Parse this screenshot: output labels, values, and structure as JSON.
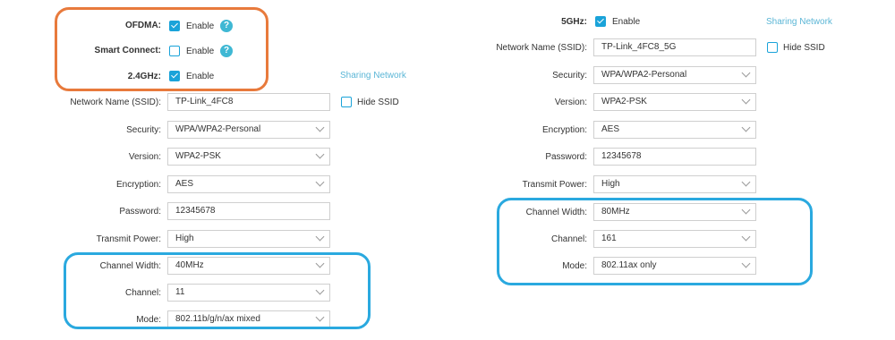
{
  "left": {
    "ofdma": {
      "label": "OFDMA:",
      "checkbox_label": "Enable",
      "checked": true
    },
    "smart_connect": {
      "label": "Smart Connect:",
      "checkbox_label": "Enable",
      "checked": false
    },
    "band_24": {
      "label": "2.4GHz:",
      "checkbox_label": "Enable",
      "checked": true
    },
    "sharing_network_link": "Sharing Network",
    "ssid": {
      "label": "Network Name (SSID):",
      "value": "TP-Link_4FC8"
    },
    "hide_ssid": "Hide SSID",
    "security": {
      "label": "Security:",
      "value": "WPA/WPA2-Personal"
    },
    "version": {
      "label": "Version:",
      "value": "WPA2-PSK"
    },
    "encryption": {
      "label": "Encryption:",
      "value": "AES"
    },
    "password": {
      "label": "Password:",
      "value": "12345678"
    },
    "transmit_power": {
      "label": "Transmit Power:",
      "value": "High"
    },
    "channel_width": {
      "label": "Channel Width:",
      "value": "40MHz"
    },
    "channel": {
      "label": "Channel:",
      "value": "11"
    },
    "mode": {
      "label": "Mode:",
      "value": "802.11b/g/n/ax mixed"
    }
  },
  "right": {
    "band_5": {
      "label": "5GHz:",
      "checkbox_label": "Enable",
      "checked": true
    },
    "sharing_network_link": "Sharing Network",
    "ssid": {
      "label": "Network Name (SSID):",
      "value": "TP-Link_4FC8_5G"
    },
    "hide_ssid": "Hide SSID",
    "security": {
      "label": "Security:",
      "value": "WPA/WPA2-Personal"
    },
    "version": {
      "label": "Version:",
      "value": "WPA2-PSK"
    },
    "encryption": {
      "label": "Encryption:",
      "value": "AES"
    },
    "password": {
      "label": "Password:",
      "value": "12345678"
    },
    "transmit_power": {
      "label": "Transmit Power:",
      "value": "High"
    },
    "channel_width": {
      "label": "Channel Width:",
      "value": "80MHz"
    },
    "channel": {
      "label": "Channel:",
      "value": "161"
    },
    "mode": {
      "label": "Mode:",
      "value": "802.11ax only"
    }
  },
  "help_glyph": "?",
  "colors": {
    "accent": "#1aa3d9",
    "link": "#5bb6d6",
    "highlight_orange": "#e87a3c",
    "highlight_blue": "#2aa9df"
  }
}
